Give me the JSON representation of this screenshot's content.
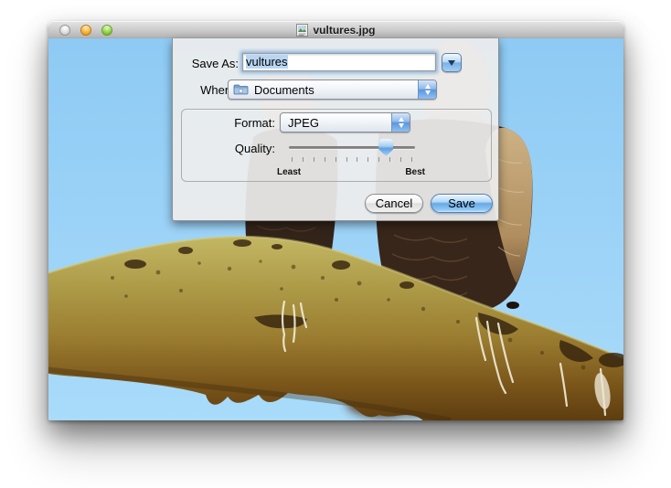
{
  "window": {
    "title": "vultures.jpg"
  },
  "sheet": {
    "save_as": {
      "label": "Save As:",
      "value": "vultures"
    },
    "where": {
      "label": "Where:",
      "value": "Documents"
    },
    "format": {
      "label": "Format:",
      "value": "JPEG"
    },
    "quality": {
      "label": "Quality:",
      "min_label": "Least",
      "max_label": "Best",
      "percent": 77,
      "tick_count": 12
    },
    "buttons": {
      "cancel": "Cancel",
      "save": "Save"
    }
  },
  "colors": {
    "accent_blue": "#67a8e5",
    "selection_blue": "#b8d6f2",
    "sky_blue": "#9bd2f7",
    "titlebar_gray": "#c6c6c6"
  }
}
